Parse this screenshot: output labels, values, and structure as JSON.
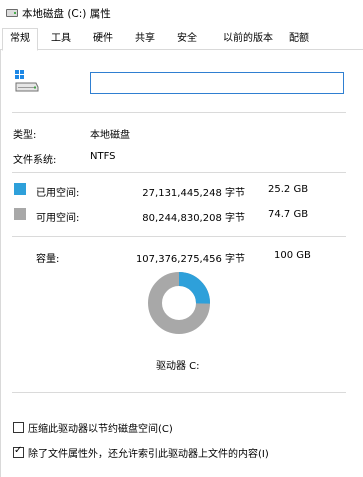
{
  "window": {
    "title": "本地磁盘 (C:) 属性"
  },
  "tabs": [
    {
      "label": "常规"
    },
    {
      "label": "工具"
    },
    {
      "label": "硬件"
    },
    {
      "label": "共享"
    },
    {
      "label": "安全"
    },
    {
      "label": "以前的版本"
    },
    {
      "label": "配额"
    }
  ],
  "general": {
    "name_value": "",
    "type_label": "类型:",
    "type_value": "本地磁盘",
    "fs_label": "文件系统:",
    "fs_value": "NTFS",
    "used": {
      "label": "已用空间:",
      "bytes": "27,131,445,248 字节",
      "size": "25.2 GB",
      "color": "#2ea0da"
    },
    "free": {
      "label": "可用空间:",
      "bytes": "80,244,830,208 字节",
      "size": "74.7 GB",
      "color": "#a8a8a8"
    },
    "capacity": {
      "label": "容量:",
      "bytes": "107,376,275,456 字节",
      "size": "100 GB"
    },
    "drive_label": "驱动器 C:",
    "used_fraction": 0.2527,
    "compress": {
      "label": "压缩此驱动器以节约磁盘空间(C)",
      "checked": false
    },
    "index": {
      "label": "除了文件属性外，还允许索引此驱动器上文件的内容(I)",
      "checked": true
    }
  },
  "icons": {
    "title": "drive-icon",
    "drive": "hard-drive-icon"
  }
}
